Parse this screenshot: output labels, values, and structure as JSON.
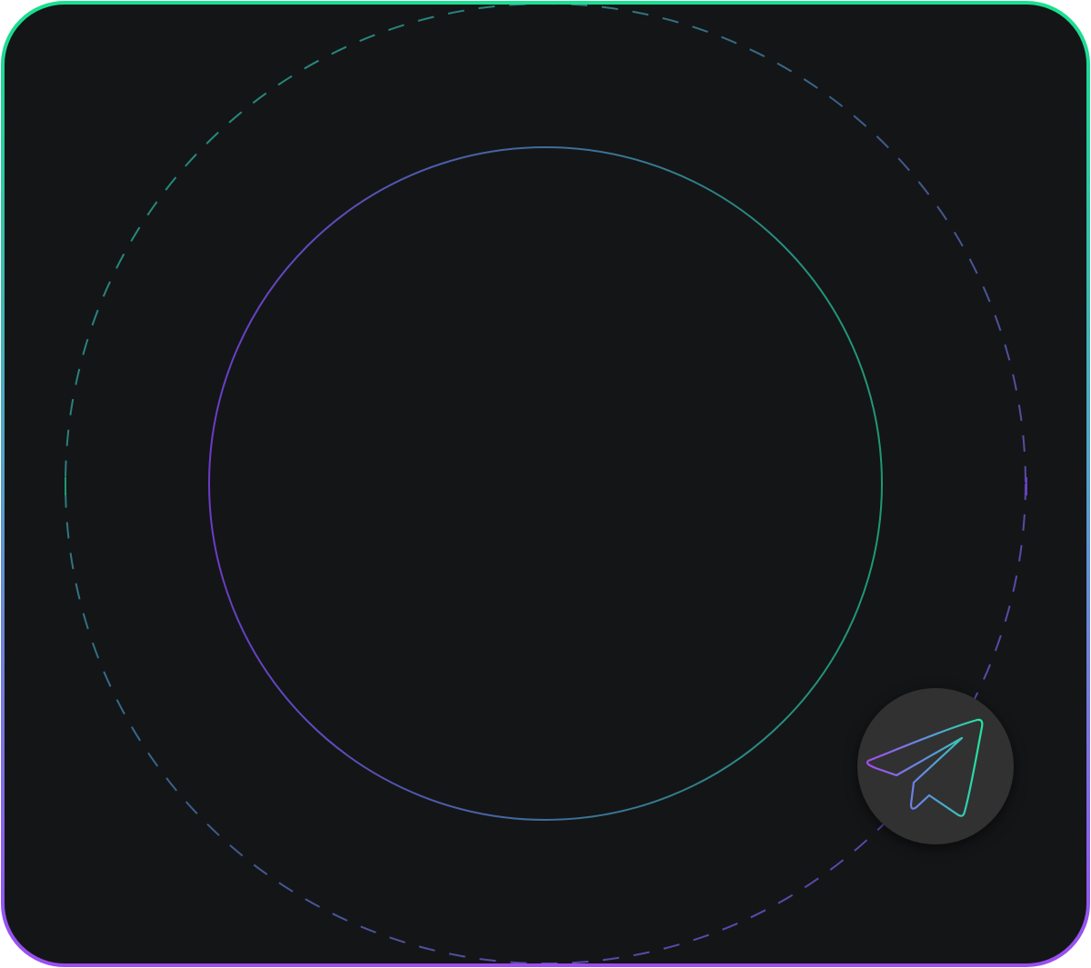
{
  "colors": {
    "background": "#141517",
    "gradient_top": "#19e08e",
    "gradient_bottom": "#9b4df2",
    "button_background": "#313131"
  },
  "icons": {
    "send_button_icon": "paper-plane-icon"
  }
}
